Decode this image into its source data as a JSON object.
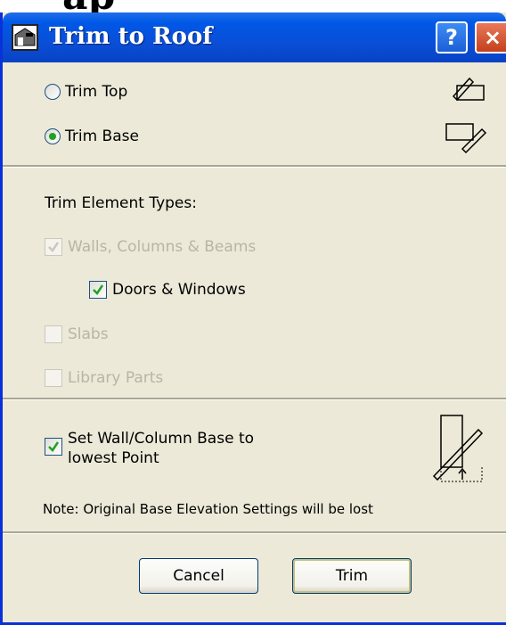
{
  "background_text": "ap",
  "window": {
    "title": "Trim to Roof",
    "help_label": "?",
    "close_label": "×"
  },
  "trim_mode": {
    "options": [
      {
        "label": "Trim Top",
        "selected": false
      },
      {
        "label": "Trim Base",
        "selected": true
      }
    ]
  },
  "element_types": {
    "heading": "Trim Element Types:",
    "walls": {
      "label": "Walls, Columns & Beams",
      "checked": true,
      "enabled": false
    },
    "doors": {
      "label": "Doors & Windows",
      "checked": true,
      "enabled": true
    },
    "slabs": {
      "label": "Slabs",
      "checked": false,
      "enabled": false
    },
    "library": {
      "label": "Library Parts",
      "checked": false,
      "enabled": false
    }
  },
  "base_option": {
    "label_line1": "Set Wall/Column Base to",
    "label_line2": "lowest Point",
    "checked": true,
    "note": "Note: Original Base Elevation Settings will be lost"
  },
  "buttons": {
    "cancel": "Cancel",
    "trim": "Trim"
  },
  "colors": {
    "titlebar": "#0a4fd8",
    "dialog_bg": "#ece9d8",
    "check_mark": "#21a121",
    "disabled_text": "#b9b5a3"
  }
}
